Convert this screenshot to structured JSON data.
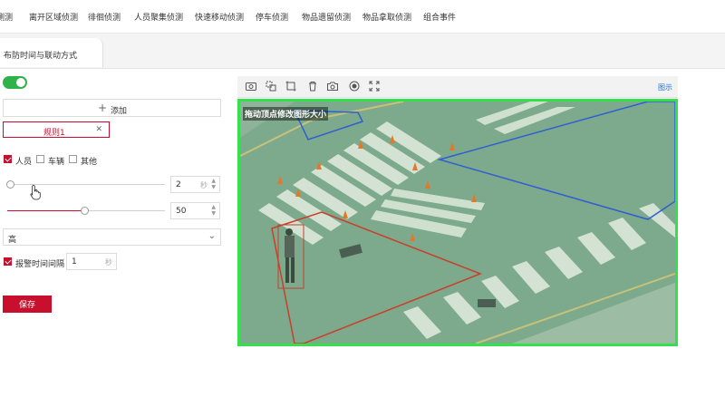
{
  "nav": {
    "items": [
      "测测",
      "离开区域侦测",
      "徘徊侦测",
      "人员聚集侦测",
      "快速移动侦测",
      "停车侦测",
      "物品遗留侦测",
      "物品拿取侦测",
      "组合事件"
    ]
  },
  "subtab": {
    "label": "布防时间与联动方式"
  },
  "enable_toggle": {
    "on": true
  },
  "add_button": {
    "label": "添加"
  },
  "rule_tab": {
    "label": "规则1"
  },
  "targets": [
    {
      "label": "人员",
      "checked": true
    },
    {
      "label": "车辆",
      "checked": false
    },
    {
      "label": "其他",
      "checked": false
    }
  ],
  "slider1": {
    "value": "2",
    "unit": "秒",
    "level": 0.02
  },
  "slider2": {
    "value": "50",
    "level": 0.5
  },
  "sensitivity": {
    "value": "高"
  },
  "alarm_interval": {
    "label": "报警时间间隔",
    "value": "1",
    "unit": "秒",
    "checked": true
  },
  "save_button": {
    "label": "保存"
  },
  "video": {
    "toolbar_icons": [
      "camera-view-icon",
      "region-select-icon",
      "crop-icon",
      "delete-icon",
      "snapshot-icon",
      "record-icon",
      "fullscreen-icon"
    ],
    "legend_link": "图示",
    "overlay_text": "拖动顶点修改图形大小"
  },
  "colors": {
    "accent": "#c8102e",
    "toggle_on": "#2fb24a",
    "video_border": "#36e04d",
    "region_blue": "#2f5fd0",
    "region_red": "#c8402a",
    "link": "#1f6fd1"
  }
}
